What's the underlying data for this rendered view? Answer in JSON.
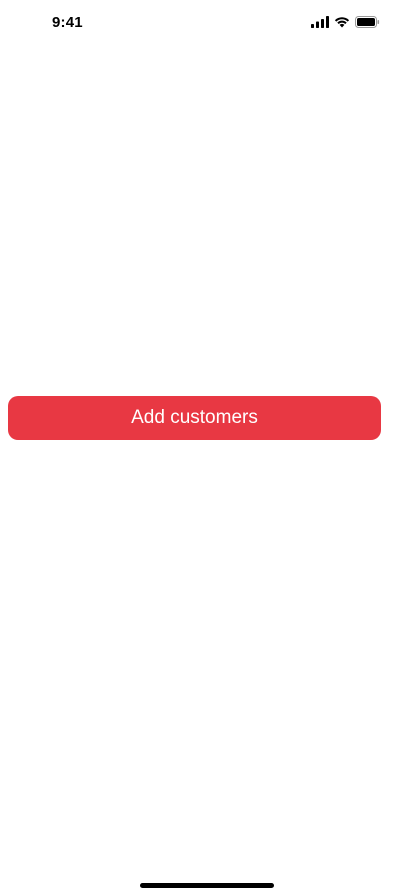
{
  "status_bar": {
    "time": "9:41",
    "icons": [
      "cellular-signal-icon",
      "wifi-icon",
      "battery-icon"
    ]
  },
  "main": {
    "add_customers_label": "Add customers",
    "button_color": "#e83843",
    "button_text_color": "#ffffff"
  },
  "colors": {
    "background": "#ffffff"
  }
}
